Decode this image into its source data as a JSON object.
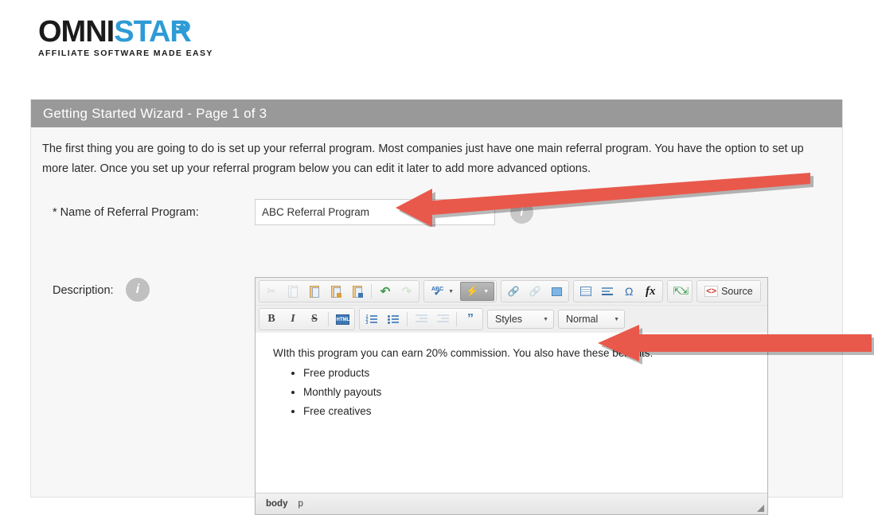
{
  "brand": {
    "name_dark": "OMNI",
    "name_light": "STAR",
    "tagline": "AFFILIATE SOFTWARE MADE EASY",
    "accent_color": "#2e9bd6"
  },
  "panel": {
    "header_title": "Getting Started Wizard - Page 1 of 3",
    "header_bg": "#999999",
    "intro_paragraph": "The first thing you are going to do is set up your referral program. Most companies just have one main referral program. You have the option to set up more later. Once you set up your referral program below you can edit it later to add more advanced options."
  },
  "form": {
    "name_field": {
      "label": "* Name of Referral Program:",
      "value": "ABC Referral Program",
      "placeholder": "",
      "info_icon": "info-icon",
      "info_glyph": "i"
    },
    "description_field": {
      "label": "Description:",
      "info_icon": "info-icon",
      "info_glyph": "i"
    }
  },
  "editor": {
    "toolbar_row_1": [
      {
        "name": "cut-icon",
        "title": "Cut",
        "disabled": true
      },
      {
        "name": "copy-icon",
        "title": "Copy",
        "disabled": true
      },
      {
        "name": "paste-icon",
        "title": "Paste",
        "disabled": false
      },
      {
        "name": "paste-as-text-icon",
        "title": "Paste as plain text",
        "disabled": false
      },
      {
        "name": "paste-from-word-icon",
        "title": "Paste from Word",
        "disabled": false
      },
      {
        "name": "undo-icon",
        "title": "Undo",
        "disabled": false
      },
      {
        "name": "redo-icon",
        "title": "Redo",
        "disabled": true
      },
      {
        "name": "spell-check-icon",
        "title": "Spell Check As You Type",
        "disabled": false
      },
      {
        "name": "remove-format-icon",
        "title": "Remove Format",
        "disabled": false
      },
      {
        "name": "link-icon",
        "title": "Link",
        "disabled": false
      },
      {
        "name": "unlink-icon",
        "title": "Unlink",
        "disabled": true
      },
      {
        "name": "anchor-icon",
        "title": "Anchor",
        "disabled": false
      },
      {
        "name": "table-icon",
        "title": "Table",
        "disabled": false
      },
      {
        "name": "horizontal-rule-icon",
        "title": "Horizontal Line",
        "disabled": false
      },
      {
        "name": "special-character-icon",
        "title": "Insert Special Character",
        "disabled": false
      },
      {
        "name": "math-formula-icon",
        "title": "Math Formula",
        "disabled": false
      },
      {
        "name": "maximize-icon",
        "title": "Maximize",
        "disabled": false
      }
    ],
    "source_button_label": "Source",
    "toolbar_row_2": [
      {
        "name": "bold-icon",
        "title": "Bold",
        "glyph": "B"
      },
      {
        "name": "italic-icon",
        "title": "Italic",
        "glyph": "I"
      },
      {
        "name": "strikethrough-icon",
        "title": "Strike Through",
        "glyph": "S"
      },
      {
        "name": "remove-html-format-icon",
        "title": "Remove Format",
        "glyph": "HTML"
      },
      {
        "name": "numbered-list-icon",
        "title": "Insert/Remove Numbered List"
      },
      {
        "name": "bulleted-list-icon",
        "title": "Insert/Remove Bulleted List"
      },
      {
        "name": "decrease-indent-icon",
        "title": "Decrease Indent"
      },
      {
        "name": "increase-indent-icon",
        "title": "Increase Indent"
      },
      {
        "name": "blockquote-icon",
        "title": "Block Quote"
      }
    ],
    "styles_dropdown": {
      "label": "Styles",
      "caret": "chevron-down-icon"
    },
    "format_dropdown": {
      "label": "Normal",
      "caret": "chevron-down-icon"
    },
    "content": {
      "paragraph": "WIth this program you can earn 20% commission. You also have these benefits:",
      "bullets": [
        "Free products",
        "Monthly payouts",
        "Free creatives"
      ]
    },
    "status_breadcrumb": [
      "body",
      "p"
    ],
    "resize_grip": "resize-grip-icon"
  },
  "annotations": {
    "color": "#e8594b",
    "arrows": [
      {
        "name": "annotation-arrow-name-field",
        "direction": "left-down"
      },
      {
        "name": "annotation-arrow-description-editor",
        "direction": "left"
      }
    ]
  }
}
